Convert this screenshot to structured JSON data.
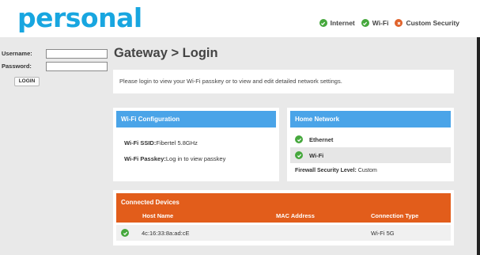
{
  "brand": {
    "logo_text": "personal",
    "color": "#18a6e0"
  },
  "header_status": [
    {
      "label": "Internet",
      "state": "ok"
    },
    {
      "label": "Wi-Fi",
      "state": "ok"
    },
    {
      "label": "Custom Security",
      "state": "warn"
    }
  ],
  "login": {
    "username_label": "Username:",
    "password_label": "Password:",
    "username_value": "",
    "password_value": "",
    "button_label": "LOGIN"
  },
  "page_title": "Gateway > Login",
  "intro": "Please login to view your Wi-Fi passkey or to view and edit detailed network settings.",
  "wifi_config": {
    "title": "Wi-Fi Configuration",
    "ssid_label": "Wi-Fi SSID:",
    "ssid_value": "Fibertel 5.8GHz",
    "passkey_label": "Wi-Fi Passkey:",
    "passkey_value": "Log in to view passkey"
  },
  "home_network": {
    "title": "Home Network",
    "items": [
      {
        "label": "Ethernet",
        "state": "ok"
      },
      {
        "label": "Wi-Fi",
        "state": "ok"
      }
    ],
    "firewall_label": "Firewall Security Level:",
    "firewall_value": "Custom"
  },
  "connected_devices": {
    "title": "Connected Devices",
    "columns": [
      "Host Name",
      "MAC Address",
      "Connection Type"
    ],
    "rows": [
      {
        "host": "4c:16:33:8a:ad:cE",
        "mac": "",
        "connection": "Wi-Fi 5G",
        "state": "ok"
      }
    ]
  },
  "colors": {
    "ok": "#46a83d",
    "warn": "#e0632c",
    "panel_blue": "#4aa4e8",
    "panel_orange": "#e25d1b"
  }
}
